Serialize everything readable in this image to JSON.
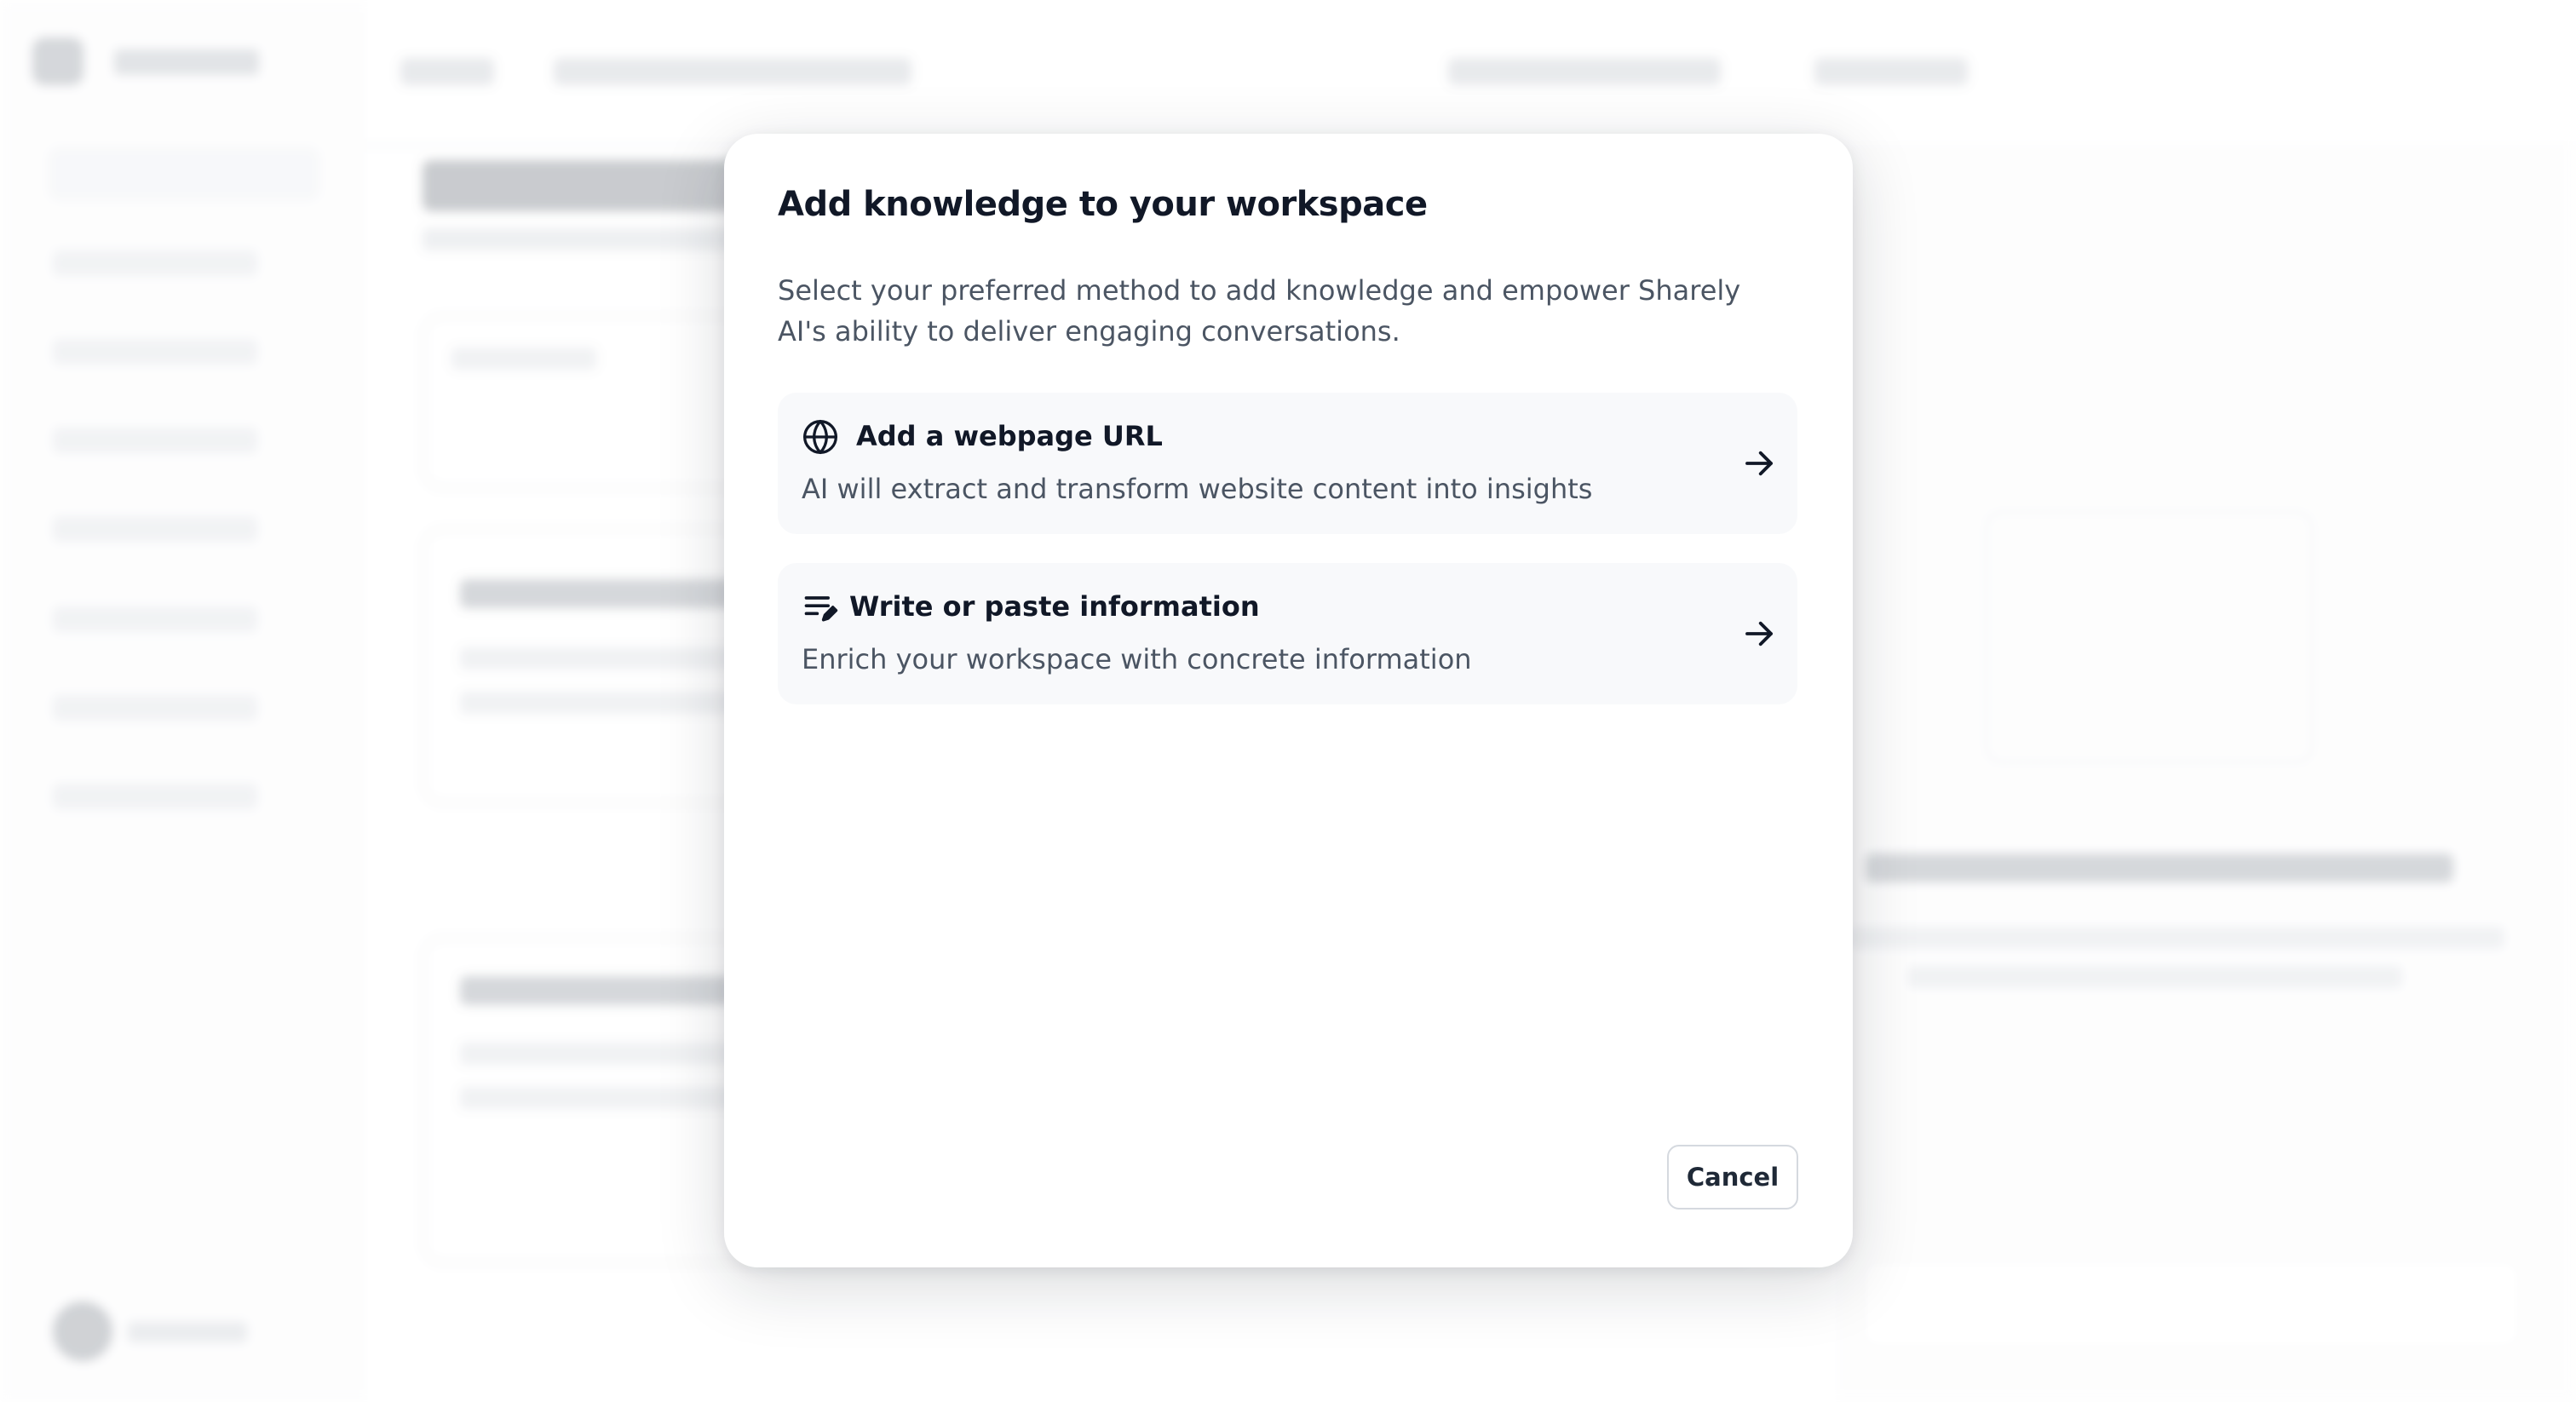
{
  "modal": {
    "title": "Add knowledge to your workspace",
    "description": "Select your preferred method to add knowledge and empower Sharely AI's ability to deliver engaging conversations.",
    "options": [
      {
        "icon": "globe-icon",
        "title": "Add a webpage URL",
        "subtitle": "AI will extract and transform website content into insights"
      },
      {
        "icon": "write-notes-icon",
        "title": "Write or paste information",
        "subtitle": "Enrich your workspace with concrete information"
      }
    ],
    "cancel_label": "Cancel"
  },
  "colors": {
    "title_text": "#111827",
    "body_text": "#4b5563",
    "option_card_bg": "#f8f9fb",
    "button_border": "#d5d9df"
  }
}
